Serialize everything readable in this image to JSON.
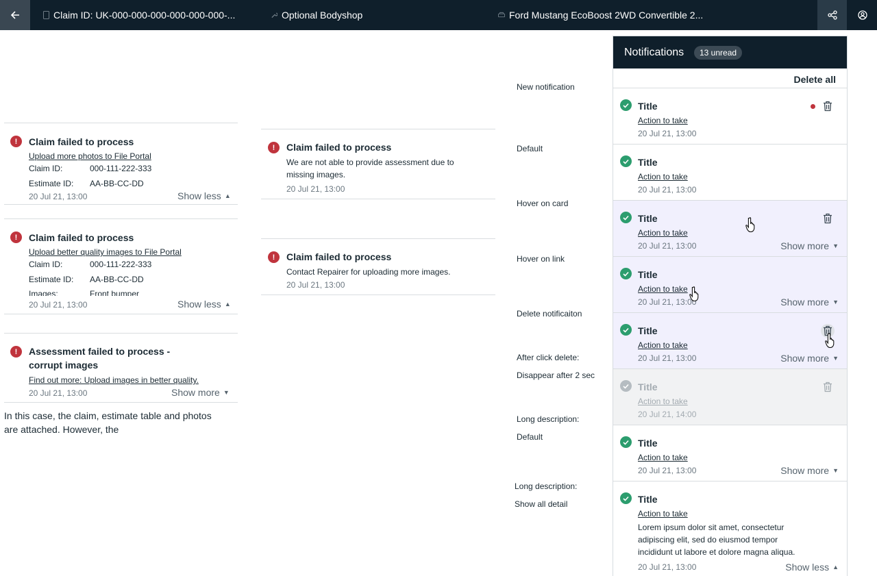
{
  "topbar": {
    "claim_id": "Claim ID: UK-000-000-000-000-000-000-...",
    "bodyshop": "Optional Bodyshop",
    "vehicle": "Ford Mustang EcoBoost 2WD Convertible 2..."
  },
  "left_examples": [
    {
      "title": "Claim failed to process",
      "link": "Upload more photos to File Portal",
      "fields": [
        {
          "key": "Claim ID:",
          "value": "000-111-222-333"
        },
        {
          "key": "Estimate ID:",
          "value": "AA-BB-CC-DD"
        }
      ],
      "time": "20 Jul 21, 13:00",
      "toggle": "Show less"
    },
    {
      "title": "Claim failed to process",
      "link": "Upload better quality images to File Portal",
      "fields": [
        {
          "key": "Claim ID:",
          "value": "000-111-222-333"
        },
        {
          "key": "Estimate ID:",
          "value": "AA-BB-CC-DD"
        },
        {
          "key": "Images:",
          "value": "Front bumper"
        }
      ],
      "time": "20 Jul 21, 13:00",
      "toggle": "Show less"
    },
    {
      "title_line1": "Assessment failed to process -",
      "title_line2": "corrupt images",
      "link": "Find out more: Upload images in better quality.",
      "time": "20 Jul 21, 13:00",
      "toggle": "Show more"
    }
  ],
  "left_note": {
    "line1": "In this case, the claim, estimate table and photos",
    "line2": "are attached. However, the"
  },
  "middle_examples": [
    {
      "title": "Claim failed to process",
      "desc_line1": "We are not able to provide assessment due to",
      "desc_line2": "missing images.",
      "time": "20 Jul 21, 13:00"
    },
    {
      "title": "Claim failed to process",
      "desc_line1": "Contact Repairer for uploading more images.",
      "time": "20 Jul 21, 13:00"
    }
  ],
  "state_labels": {
    "new": "New notification",
    "default": "Default",
    "hover_card": "Hover on card",
    "hover_link": "Hover on link",
    "delete": "Delete notificaiton",
    "after_delete": "After click delete:",
    "disappear": "Disappear after 2 sec",
    "long_desc": "Long description:",
    "long_default": "Default",
    "long_desc2": "Long description:",
    "show_all": "Show all detail"
  },
  "notifications": {
    "title": "Notifications",
    "unread_badge": "13 unread",
    "delete_all": "Delete all",
    "cards": [
      {
        "title": "Title",
        "action": "Action to take",
        "time": "20 Jul 21, 13:00"
      },
      {
        "title": "Title",
        "action": "Action to take",
        "time": "20 Jul 21, 13:00"
      },
      {
        "title": "Title",
        "action": "Action to take",
        "time": "20 Jul 21, 13:00",
        "more": "Show more"
      },
      {
        "title": "Title",
        "action": "Action to take",
        "time": "20 Jul 21, 13:00",
        "more": "Show more"
      },
      {
        "title": "Title",
        "action": "Action to take",
        "time": "20 Jul 21, 13:00",
        "more": "Show more"
      },
      {
        "title": "Title",
        "action": "Action to take",
        "time": "20 Jul 21, 14:00"
      },
      {
        "title": "Title",
        "action": "Action to take",
        "time": "20 Jul 21, 13:00",
        "more": "Show more"
      },
      {
        "title": "Title",
        "action": "Action to take",
        "desc_line1": "Lorem ipsum dolor sit amet, consectetur",
        "desc_line2": "adipiscing elit, sed do eiusmod tempor",
        "desc_line3": "incididunt ut labore et dolore magna aliqua.",
        "time": "20 Jul 21, 13:00",
        "more": "Show less"
      }
    ]
  },
  "colors": {
    "topbar_bg": "#0f1f2b",
    "error_red": "#c0343d",
    "success_green": "#2c9d6e",
    "hover_bg": "#f1f0fd"
  }
}
